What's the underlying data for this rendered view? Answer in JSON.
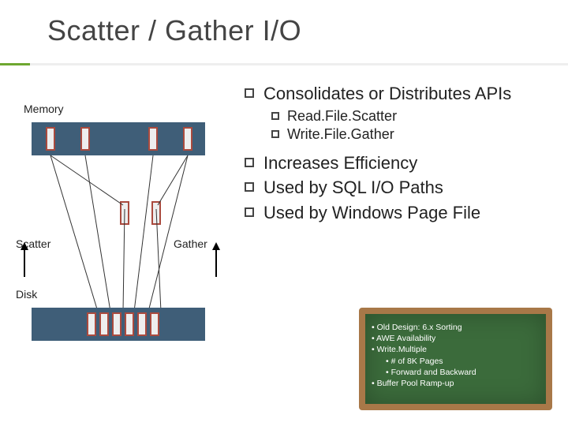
{
  "title": "Scatter / Gather I/O",
  "diagram": {
    "memory_label": "Memory",
    "scatter_label": "Scatter",
    "gather_label": "Gather",
    "disk_label": "Disk"
  },
  "bullets": {
    "b1": "Consolidates or Distributes APIs",
    "s1": "Read.File.Scatter",
    "s2": "Write.File.Gather",
    "b2": "Increases Efficiency",
    "b3": "Used by SQL I/O Paths",
    "b4": "Used by Windows Page File"
  },
  "chalk": {
    "l1": "• Old Design: 6.x Sorting",
    "l2": "• AWE Availability",
    "l3": "• Write.Multiple",
    "l4": "• # of 8K Pages",
    "l5": "• Forward and Backward",
    "l6": "• Buffer Pool Ramp-up"
  }
}
